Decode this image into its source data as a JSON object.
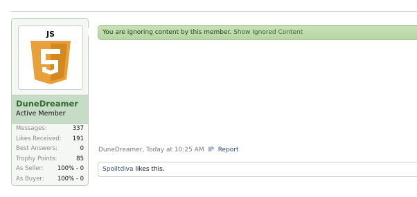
{
  "colors": {
    "avatar_orange": "#e8a13a",
    "avatar_orange_dark": "#d4891f",
    "username_green": "#2f6b2f",
    "ignore_bar_green": "#c9e1b8"
  },
  "avatar": {
    "icon": "js5-shield-icon",
    "logo_text": "JS"
  },
  "user": {
    "name": "DuneDreamer",
    "title": "Active Member",
    "stats": [
      {
        "label": "Messages:",
        "value": "337"
      },
      {
        "label": "Likes Received:",
        "value": "191"
      },
      {
        "label": "Best Answers:",
        "value": "0"
      },
      {
        "label": "Trophy Points:",
        "value": "85"
      },
      {
        "label": "As Seller:",
        "value": "100% - 0"
      },
      {
        "label": "As Buyer:",
        "value": "100% - 0"
      }
    ]
  },
  "ignored_notice": {
    "text": "You are ignoring content by this member.",
    "link_label": "Show Ignored Content"
  },
  "post_meta": {
    "author_time": "DuneDreamer, Today at 10:25 AM",
    "ip_label": "IP",
    "report_label": "Report"
  },
  "likes": {
    "user": "Spoiltdiva",
    "suffix": "likes this."
  }
}
